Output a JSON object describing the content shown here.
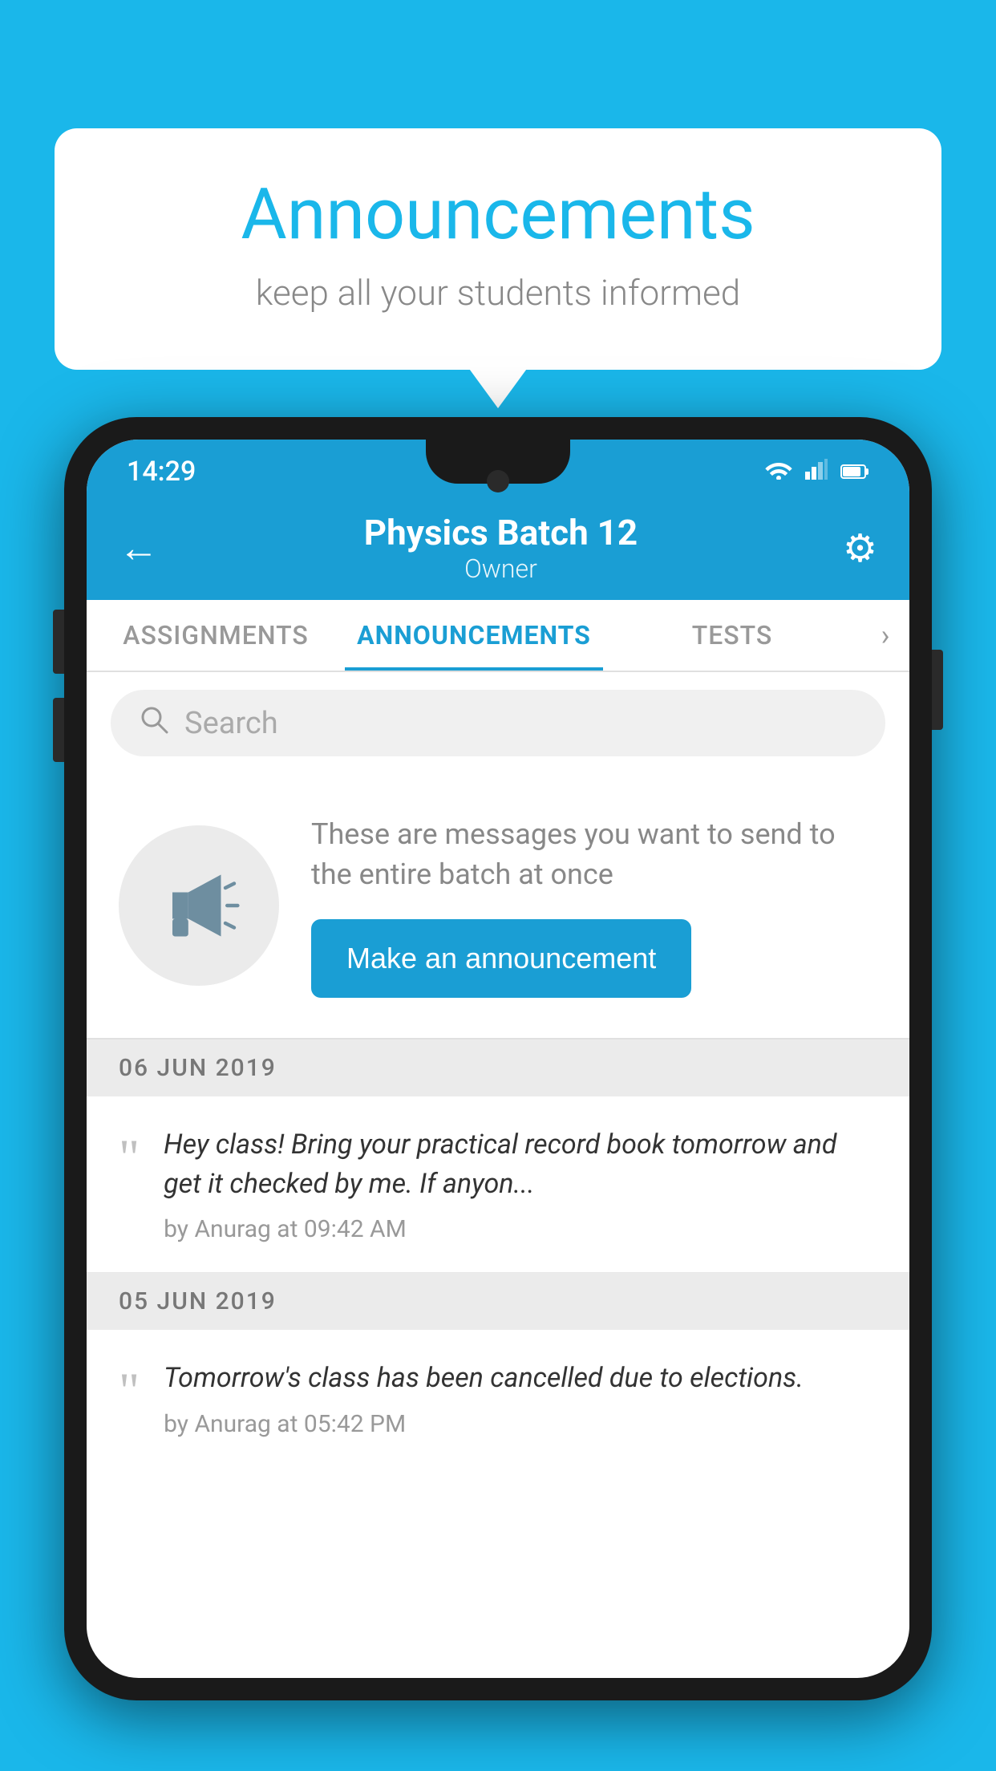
{
  "bubble": {
    "title": "Announcements",
    "subtitle": "keep all your students informed"
  },
  "status_bar": {
    "time": "14:29",
    "wifi_icon": "wifi",
    "signal_icon": "signal",
    "battery_icon": "battery"
  },
  "header": {
    "back_icon": "←",
    "title": "Physics Batch 12",
    "subtitle": "Owner",
    "settings_icon": "⚙"
  },
  "tabs": [
    {
      "label": "ASSIGNMENTS",
      "active": false
    },
    {
      "label": "ANNOUNCEMENTS",
      "active": true
    },
    {
      "label": "TESTS",
      "active": false
    }
  ],
  "search": {
    "placeholder": "Search"
  },
  "announcement_prompt": {
    "description": "These are messages you want to send to the entire batch at once",
    "button_label": "Make an announcement"
  },
  "announcements": [
    {
      "date": "06  JUN  2019",
      "message": "Hey class! Bring your practical record book tomorrow and get it checked by me. If anyon...",
      "meta": "by Anurag at 09:42 AM"
    },
    {
      "date": "05  JUN  2019",
      "message": "Tomorrow's class has been cancelled due to elections.",
      "meta": "by Anurag at 05:42 PM"
    }
  ]
}
